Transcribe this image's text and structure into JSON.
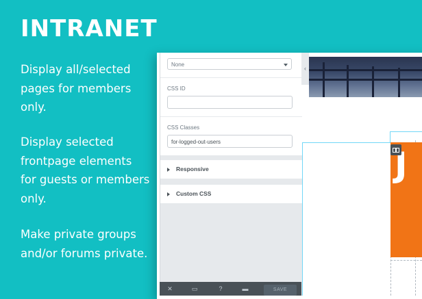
{
  "title": "INTRANET",
  "bullets": [
    "Display all/selected pages for members only.",
    "Display selected frontpage elements for guests or members only.",
    "Make private groups and/or forums private."
  ],
  "panel": {
    "select_value": "None",
    "css_id_label": "CSS ID",
    "css_id_value": "",
    "css_classes_label": "CSS Classes",
    "css_classes_value": "for-logged-out-users",
    "sections": [
      "Responsive",
      "Custom CSS"
    ],
    "save_label": "SAVE"
  },
  "canvas": {
    "letter": "J"
  },
  "colors": {
    "background": "#12bfc3",
    "accent": "#f17416",
    "panel_dark": "#495157",
    "outline": "#71d7f7"
  },
  "icons": [
    "close-icon",
    "desktop-icon",
    "help-icon",
    "folder-icon",
    "column-handle-icon",
    "collapse-arrow-icon"
  ]
}
